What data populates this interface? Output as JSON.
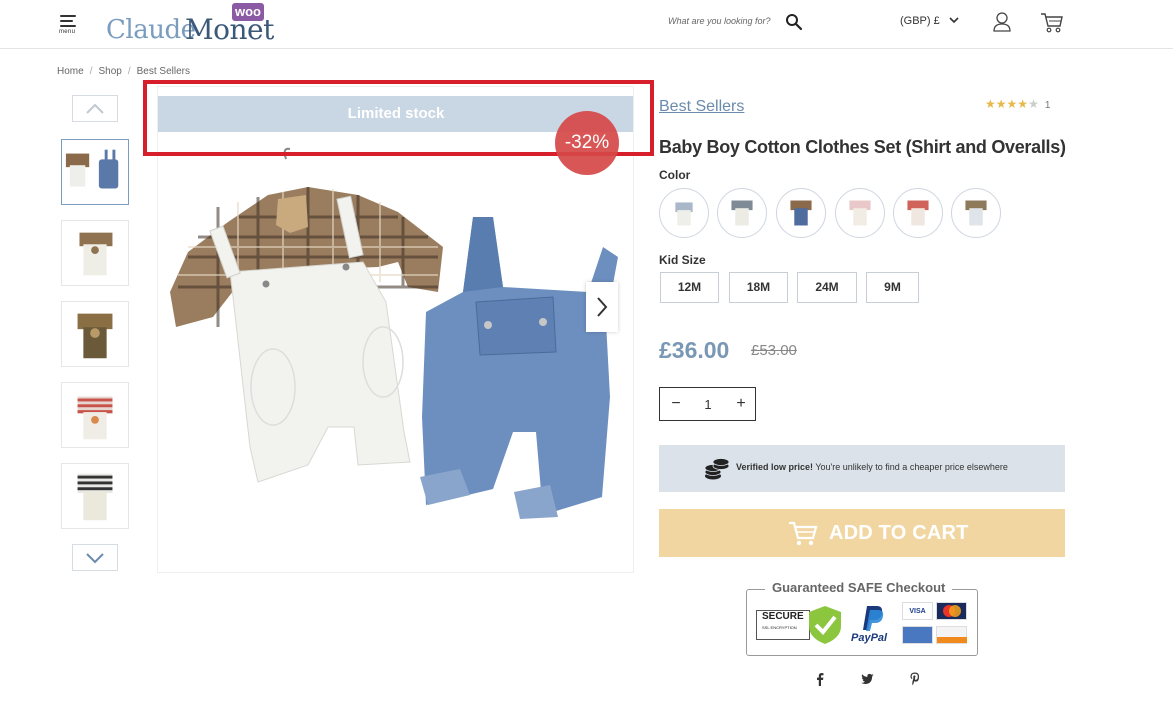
{
  "header": {
    "menu_label": "menu",
    "logo_claude": "Claude",
    "logo_monet": "Monet",
    "logo_badge": "woo",
    "search_placeholder": "What are you looking for?",
    "currency": "(GBP) £"
  },
  "breadcrumb": [
    "Home",
    "Shop",
    "Best Sellers"
  ],
  "gallery": {
    "limited_stock": "Limited stock",
    "discount": "-32%"
  },
  "product": {
    "category": "Best Sellers",
    "rating": 4,
    "rating_max": 5,
    "review_count": "1",
    "title": "Baby Boy Cotton Clothes Set (Shirt and Overalls)",
    "color_label": "Color",
    "size_label": "Kid Size",
    "sizes": [
      "12M",
      "18M",
      "24M",
      "9M"
    ],
    "price": "£36.00",
    "old_price": "£53.00",
    "quantity": "1",
    "verified_bold": "Verified low price!",
    "verified_rest": " You're unlikely to find a cheaper price elsewhere",
    "add_to_cart": "ADD TO CART"
  },
  "checkout": {
    "title": "Guaranteed SAFE Checkout",
    "secure_label": "SECURE",
    "ssl_label": "SSL ENCRYPTION",
    "paypal": "PayPal",
    "visa": "VISA"
  },
  "colors": {
    "accent": "#7a97b4",
    "add_to_cart_bg": "#f1d6a2",
    "limited_stock_bg": "#c9d6e3",
    "discount_bg": "#d64848",
    "highlight": "#d61f2a"
  }
}
